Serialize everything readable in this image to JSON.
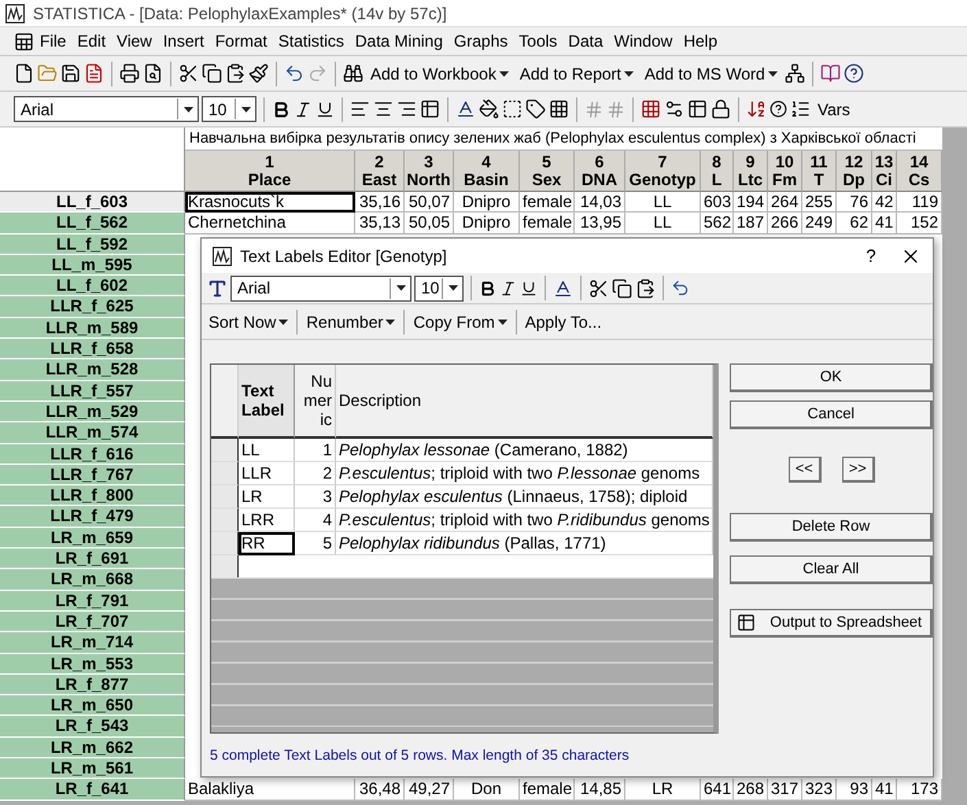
{
  "window": {
    "title": "STATISTICA - [Data: PelophylaxExamples* (14v by 57c)]"
  },
  "menu": [
    "File",
    "Edit",
    "View",
    "Insert",
    "Format",
    "Statistics",
    "Data Mining",
    "Graphs",
    "Tools",
    "Data",
    "Window",
    "Help"
  ],
  "toolbar": {
    "buttons": [
      "Add to Workbook",
      "Add to Report",
      "Add to MS Word"
    ]
  },
  "format_bar": {
    "font": "Arial",
    "size": "10",
    "vars": "Vars"
  },
  "sheet": {
    "title": "Навчальна вибірка результатів опису зелених жаб (Pelophylax esculentus complex) з Харківської області",
    "columns": [
      {
        "number": "1",
        "name": "Place"
      },
      {
        "number": "2",
        "name": "East"
      },
      {
        "number": "3",
        "name": "North"
      },
      {
        "number": "4",
        "name": "Basin"
      },
      {
        "number": "5",
        "name": "Sex"
      },
      {
        "number": "6",
        "name": "DNA"
      },
      {
        "number": "7",
        "name": "Genotyp"
      },
      {
        "number": "8",
        "name": "L"
      },
      {
        "number": "9",
        "name": "Ltc"
      },
      {
        "number": "10",
        "name": "Fm"
      },
      {
        "number": "11",
        "name": "T"
      },
      {
        "number": "12",
        "name": "Dp"
      },
      {
        "number": "13",
        "name": "Ci"
      },
      {
        "number": "14",
        "name": "Cs"
      }
    ],
    "rows": [
      {
        "header": "LL_f_603",
        "selected": true,
        "cells": [
          "Krasnocuts`k",
          "35,16",
          "50,07",
          "Dnipro",
          "female",
          "14,03",
          "LL",
          "603",
          "194",
          "264",
          "255",
          "76",
          "42",
          "119"
        ]
      },
      {
        "header": "LL_f_562",
        "selected": false,
        "cells": [
          "Chernetchina",
          "35,13",
          "50,05",
          "Dnipro",
          "female",
          "13,95",
          "LL",
          "562",
          "187",
          "266",
          "249",
          "62",
          "41",
          "152"
        ]
      },
      {
        "header": "LL_f_592",
        "selected": false
      },
      {
        "header": "LL_m_595",
        "selected": false
      },
      {
        "header": "LL_f_602",
        "selected": false
      },
      {
        "header": "LLR_f_625",
        "selected": false
      },
      {
        "header": "LLR_m_589",
        "selected": false
      },
      {
        "header": "LLR_f_658",
        "selected": false
      },
      {
        "header": "LLR_m_528",
        "selected": false
      },
      {
        "header": "LLR_f_557",
        "selected": false
      },
      {
        "header": "LLR_m_529",
        "selected": false
      },
      {
        "header": "LLR_m_574",
        "selected": false
      },
      {
        "header": "LLR_f_616",
        "selected": false
      },
      {
        "header": "LLR_f_767",
        "selected": false
      },
      {
        "header": "LLR_f_800",
        "selected": false
      },
      {
        "header": "LLR_f_479",
        "selected": false
      },
      {
        "header": "LR_m_659",
        "selected": false
      },
      {
        "header": "LR_f_691",
        "selected": false
      },
      {
        "header": "LR_m_668",
        "selected": false
      },
      {
        "header": "LR_f_791",
        "selected": false
      },
      {
        "header": "LR_f_707",
        "selected": false
      },
      {
        "header": "LR_m_714",
        "selected": false
      },
      {
        "header": "LR_m_553",
        "selected": false
      },
      {
        "header": "LR_f_877",
        "selected": false
      },
      {
        "header": "LR_m_650",
        "selected": false
      },
      {
        "header": "LR_f_543",
        "selected": false
      },
      {
        "header": "LR_m_662",
        "selected": false
      },
      {
        "header": "LR_m_561",
        "selected": false
      },
      {
        "header": "LR_f_641",
        "selected": false,
        "cells": [
          "Balakliya",
          "36,48",
          "49,27",
          "Don",
          "female",
          "14,85",
          "LR",
          "641",
          "268",
          "317",
          "323",
          "93",
          "41",
          "173"
        ]
      }
    ]
  },
  "dialog": {
    "title": "Text Labels Editor [Genotyp]",
    "help": "?",
    "font": "Arial",
    "size": "10",
    "menu": [
      "Sort Now",
      "Renumber",
      "Copy From",
      "Apply To..."
    ],
    "columns": [
      "Text Label",
      "Nu mer ic",
      "Description"
    ],
    "rows": [
      {
        "label": "LL",
        "number": "1",
        "description": "*Pelophylax lessonae* (Camerano, 1882)",
        "selected": false
      },
      {
        "label": "LLR",
        "number": "2",
        "description": "*P.esculentus*; triploid with two *P.lessonae* genoms",
        "selected": false
      },
      {
        "label": "LR",
        "number": "3",
        "description": "*Pelophylax esculentus* (Linnaeus, 1758); diploid",
        "selected": false
      },
      {
        "label": "LRR",
        "number": "4",
        "description": "*P.esculentus*; triploid with two *P.ridibundus* genoms",
        "selected": false
      },
      {
        "label": "RR",
        "number": "5",
        "description": "*Pelophylax ridibundus* (Pallas, 1771)",
        "selected": true
      }
    ],
    "buttons": {
      "ok": "OK",
      "cancel": "Cancel",
      "prev": "<<",
      "next": ">>",
      "delete": "Delete Row",
      "clear": "Clear All",
      "output": "Output to Spreadsheet"
    },
    "status": "5 complete Text Labels out of 5 rows. Max length of 35 characters"
  }
}
